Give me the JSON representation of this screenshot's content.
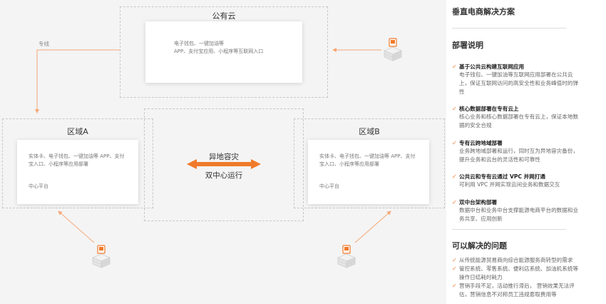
{
  "diagram": {
    "public_cloud": {
      "title": "公有云",
      "lines": [
        "电子钱包、一键加油等",
        "APP、支付宝应用、小程序等互联网入口"
      ]
    },
    "dedicated_line_label": "专线",
    "region_a": {
      "title": "区域A",
      "lines": [
        "实体卡、电子钱包、一键加油等 APP、支付",
        "宝入口、小程序等应用部署"
      ],
      "platform": "中心平台"
    },
    "region_b": {
      "title": "区域B",
      "lines": [
        "实体卡、电子钱包、一键加油等 APP、支付",
        "宝入口、小程序等应用部署"
      ],
      "platform": "中心平台"
    },
    "middle": {
      "top": "异地容灾",
      "bottom": "双中心运行"
    },
    "colors": {
      "accent": "#f07a2a",
      "arrow_light": "#f5a878"
    }
  },
  "sidebar": {
    "title": "垂直电商解决方案",
    "deploy_heading": "部署说明",
    "deploy_items": [
      {
        "title": "基于公共云构建互联网应用",
        "desc": [
          "电子钱包、一键加油等互联网应用部署在公共云",
          "上，保证互联网访问的高安全性和业务峰值时的弹",
          "性"
        ]
      },
      {
        "title": "核心数据部署在专有云上",
        "desc": [
          "核心业务和核心数据部署在专有云上，保证本地数",
          "据的安全合规"
        ]
      },
      {
        "title": "专有云跨地域部署",
        "desc": [
          "业务跨地域部署和运行，同时互为异地容灾备份，",
          "提升业务和云台的灵活性和可靠性"
        ]
      },
      {
        "title": "公共云和专有云通过 VPC 并网打通",
        "desc": [
          "可利用 VPC 并网实现云间业务和数据交互"
        ]
      },
      {
        "title": "双中台架构部署",
        "desc": [
          "数据中台和业务中台支撑能源电商平台的数据和业",
          "务共享、应用创新"
        ]
      }
    ],
    "problems_heading": "可以解决的问题",
    "problems": [
      [
        "从传统能源贸易商向综合能源服务商转型的需求"
      ],
      [
        "管控系统、零售系统、便利店系统、加油机系统等",
        "操作日结耗时耗力"
      ],
      [
        "营销手段不足，活动推行滞后， 营销效果无法评",
        "估，营销信息不对称员工违规套取费用等"
      ]
    ]
  }
}
